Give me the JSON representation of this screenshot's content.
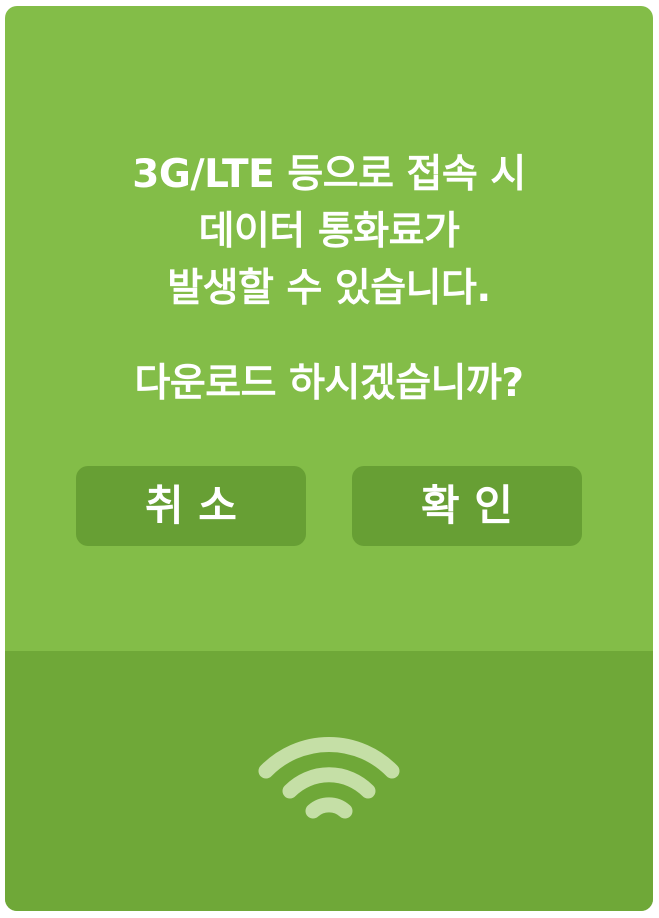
{
  "dialog": {
    "message_lines": [
      "3G/LTE 등으로 접속 시",
      "데이터 통화료가",
      "발생할 수 있습니다."
    ],
    "question": "다운로드 하시겠습니까?",
    "cancel_label": "취 소",
    "confirm_label": "확 인"
  },
  "footer": {
    "icon": "wifi-icon"
  },
  "colors": {
    "dialog_background": "#83bd48",
    "button_background": "#679f34",
    "footer_background": "#6fa838",
    "text": "#ffffff",
    "icon": "#c5dfa6"
  }
}
